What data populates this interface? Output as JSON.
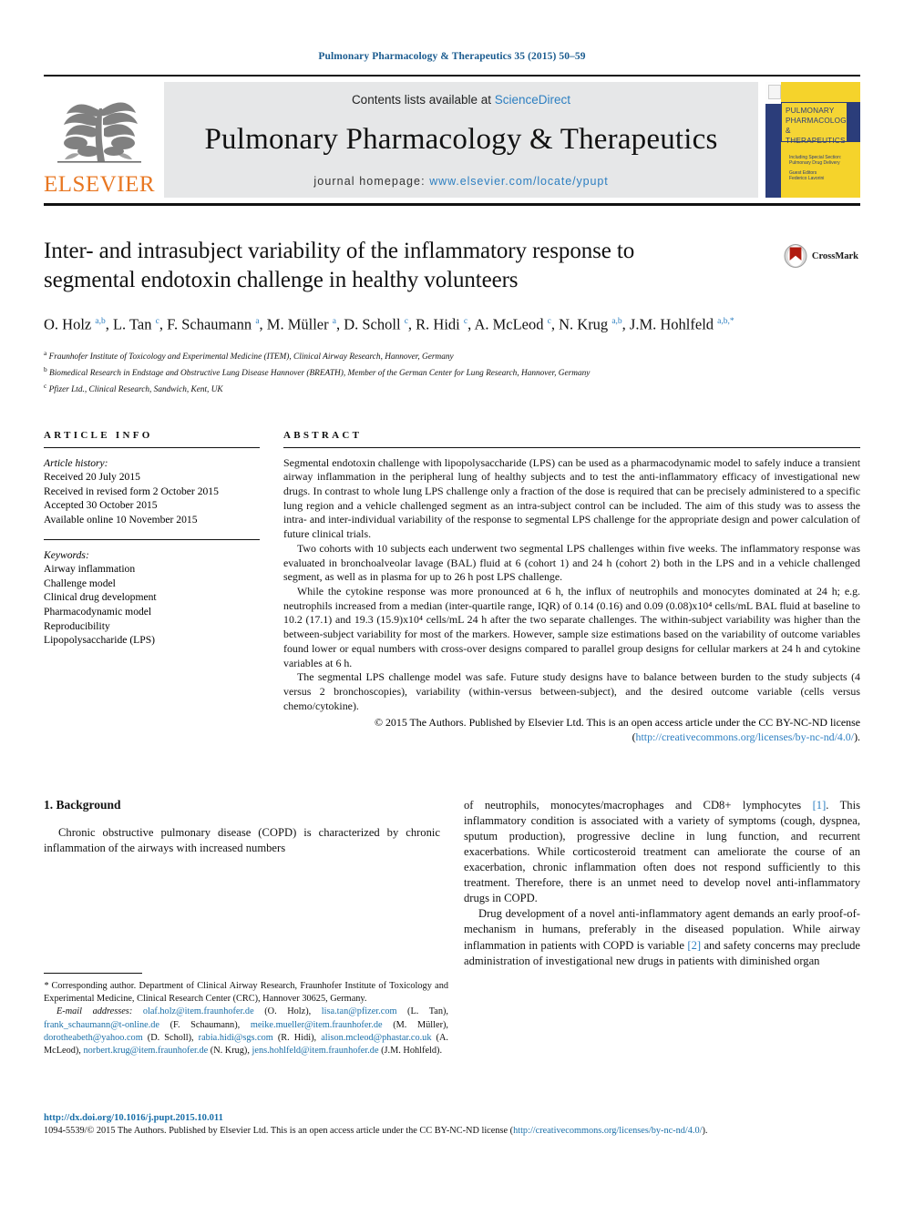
{
  "running_head": "Pulmonary Pharmacology & Therapeutics 35 (2015) 50–59",
  "masthead": {
    "publisher_name": "ELSEVIER",
    "contents_prefix": "Contents lists available at ",
    "contents_link": "ScienceDirect",
    "journal_title": "Pulmonary Pharmacology & Therapeutics",
    "homepage_label": "journal homepage:",
    "homepage_url": "www.elsevier.com/locate/ypupt",
    "cover": {
      "line1": "PULMONARY",
      "line2": "PHARMACOLOGY",
      "line3": "& THERAPEUTICS",
      "sub1": "Including Special Section:",
      "sub2": "Pulmonary Drug Delivery",
      "sub3": "Guest Editors",
      "sub4": "Federico Lavorini"
    }
  },
  "article": {
    "title": "Inter- and intrasubject variability of the inflammatory response to segmental endotoxin challenge in healthy volunteers",
    "crossmark_label": "CrossMark",
    "authors": [
      {
        "name": "O. Holz",
        "sup": "a,b",
        "sep": ", "
      },
      {
        "name": "L. Tan",
        "sup": "c",
        "sep": ", "
      },
      {
        "name": "F. Schaumann",
        "sup": "a",
        "sep": ", "
      },
      {
        "name": "M. Müller",
        "sup": "a",
        "sep": ", "
      },
      {
        "name": "D. Scholl",
        "sup": "c",
        "sep": ", "
      },
      {
        "name": "R. Hidi",
        "sup": "c",
        "sep": ", "
      },
      {
        "name": "A. McLeod",
        "sup": "c",
        "sep": ", "
      },
      {
        "name": "N. Krug",
        "sup": "a,b",
        "sep": ", "
      },
      {
        "name": "J.M. Hohlfeld",
        "sup": "a,b,*",
        "sep": ""
      }
    ],
    "affiliations": [
      {
        "marker": "a",
        "text": "Fraunhofer Institute of Toxicology and Experimental Medicine (ITEM), Clinical Airway Research, Hannover, Germany"
      },
      {
        "marker": "b",
        "text": "Biomedical Research in Endstage and Obstructive Lung Disease Hannover (BREATH), Member of the German Center for Lung Research, Hannover, Germany"
      },
      {
        "marker": "c",
        "text": "Pfizer Ltd., Clinical Research, Sandwich, Kent, UK"
      }
    ]
  },
  "article_info": {
    "heading": "ARTICLE INFO",
    "history_title": "Article history:",
    "history": [
      "Received 20 July 2015",
      "Received in revised form 2 October 2015",
      "Accepted 30 October 2015",
      "Available online 10 November 2015"
    ],
    "keywords_title": "Keywords:",
    "keywords": [
      "Airway inflammation",
      "Challenge model",
      "Clinical drug development",
      "Pharmacodynamic model",
      "Reproducibility",
      "Lipopolysaccharide (LPS)"
    ]
  },
  "abstract": {
    "heading": "ABSTRACT",
    "paragraphs": [
      "Segmental endotoxin challenge with lipopolysaccharide (LPS) can be used as a pharmacodynamic model to safely induce a transient airway inflammation in the peripheral lung of healthy subjects and to test the anti-inflammatory efficacy of investigational new drugs. In contrast to whole lung LPS challenge only a fraction of the dose is required that can be precisely administered to a specific lung region and a vehicle challenged segment as an intra-subject control can be included. The aim of this study was to assess the intra- and inter-individual variability of the response to segmental LPS challenge for the appropriate design and power calculation of future clinical trials.",
      "Two cohorts with 10 subjects each underwent two segmental LPS challenges within five weeks. The inflammatory response was evaluated in bronchoalveolar lavage (BAL) fluid at 6 (cohort 1) and 24 h (cohort 2) both in the LPS and in a vehicle challenged segment, as well as in plasma for up to 26 h post LPS challenge.",
      "While the cytokine response was more pronounced at 6 h, the influx of neutrophils and monocytes dominated at 24 h; e.g. neutrophils increased from a median (inter-quartile range, IQR) of 0.14 (0.16) and 0.09 (0.08)x10⁴ cells/mL BAL fluid at baseline to 10.2 (17.1) and 19.3 (15.9)x10⁴ cells/mL 24 h after the two separate challenges. The within-subject variability was higher than the between-subject variability for most of the markers. However, sample size estimations based on the variability of outcome variables found lower or equal numbers with cross-over designs compared to parallel group designs for cellular markers at 24 h and cytokine variables at 6 h.",
      "The segmental LPS challenge model was safe. Future study designs have to balance between burden to the study subjects (4 versus 2 bronchoscopies), variability (within-versus between-subject), and the desired outcome variable (cells versus chemo/cytokine)."
    ],
    "copyright_prefix": "© 2015 The Authors. Published by Elsevier Ltd. This is an open access article under the CC BY-NC-ND license (",
    "copyright_link": "http://creativecommons.org/licenses/by-nc-nd/4.0/",
    "copyright_suffix": ")."
  },
  "background": {
    "heading": "1. Background",
    "left_paragraph": "Chronic obstructive pulmonary disease (COPD) is characterized by chronic inflammation of the airways with increased numbers",
    "right_paragraph_1_a": "of neutrophils, monocytes/macrophages and CD8+ lymphocytes ",
    "right_paragraph_1_ref": "[1]",
    "right_paragraph_1_b": ". This inflammatory condition is associated with a variety of symptoms (cough, dyspnea, sputum production), progressive decline in lung function, and recurrent exacerbations. While corticosteroid treatment can ameliorate the course of an exacerbation, chronic inflammation often does not respond sufficiently to this treatment. Therefore, there is an unmet need to develop novel anti-inflammatory drugs in COPD.",
    "right_paragraph_2_a": "Drug development of a novel anti-inflammatory agent demands an early proof-of-mechanism in humans, preferably in the diseased population. While airway inflammation in patients with COPD is variable ",
    "right_paragraph_2_ref": "[2]",
    "right_paragraph_2_b": " and safety concerns may preclude administration of investigational new drugs in patients with diminished organ"
  },
  "footnotes": {
    "corresponding_marker": "*",
    "corresponding_text": " Corresponding author. Department of Clinical Airway Research, Fraunhofer Institute of Toxicology and Experimental Medicine, Clinical Research Center (CRC), Hannover 30625, Germany.",
    "email_label": "E-mail addresses:",
    "emails": [
      {
        "address": "olaf.holz@item.fraunhofer.de",
        "person": " (O. Holz), "
      },
      {
        "address": "lisa.tan@pfizer.com",
        "person": " (L. Tan), "
      },
      {
        "address": "frank_schaumann@t-online.de",
        "person": " (F. Schaumann), "
      },
      {
        "address": "meike.mueller@item.fraunhofer.de",
        "person": " (M. Müller), "
      },
      {
        "address": "dorotheabeth@yahoo.com",
        "person": " (D. Scholl), "
      },
      {
        "address": "rabia.hidi@sgs.com",
        "person": " (R. Hidi), "
      },
      {
        "address": "alison.mcleod@phastar.co.uk",
        "person": " (A. McLeod), "
      },
      {
        "address": "norbert.krug@item.fraunhofer.de",
        "person": " (N. Krug), "
      },
      {
        "address": "jens.hohlfeld@item.fraunhofer.de",
        "person": " (J.M. Hohlfeld)."
      }
    ]
  },
  "page_footer": {
    "doi": "http://dx.doi.org/10.1016/j.pupt.2015.10.011",
    "issn_copy_prefix": "1094-5539/© 2015 The Authors. Published by Elsevier Ltd. This is an open access article under the CC BY-NC-ND license (",
    "issn_copy_link": "http://creativecommons.org/licenses/by-nc-nd/4.0/",
    "issn_copy_suffix": ")."
  },
  "colors": {
    "link_blue": "#2d7fc1",
    "elsevier_orange": "#E87722",
    "cover_yellow": "#f5d32b",
    "cover_navy": "#2b3d7a",
    "masthead_grey": "#e6e7e8"
  }
}
